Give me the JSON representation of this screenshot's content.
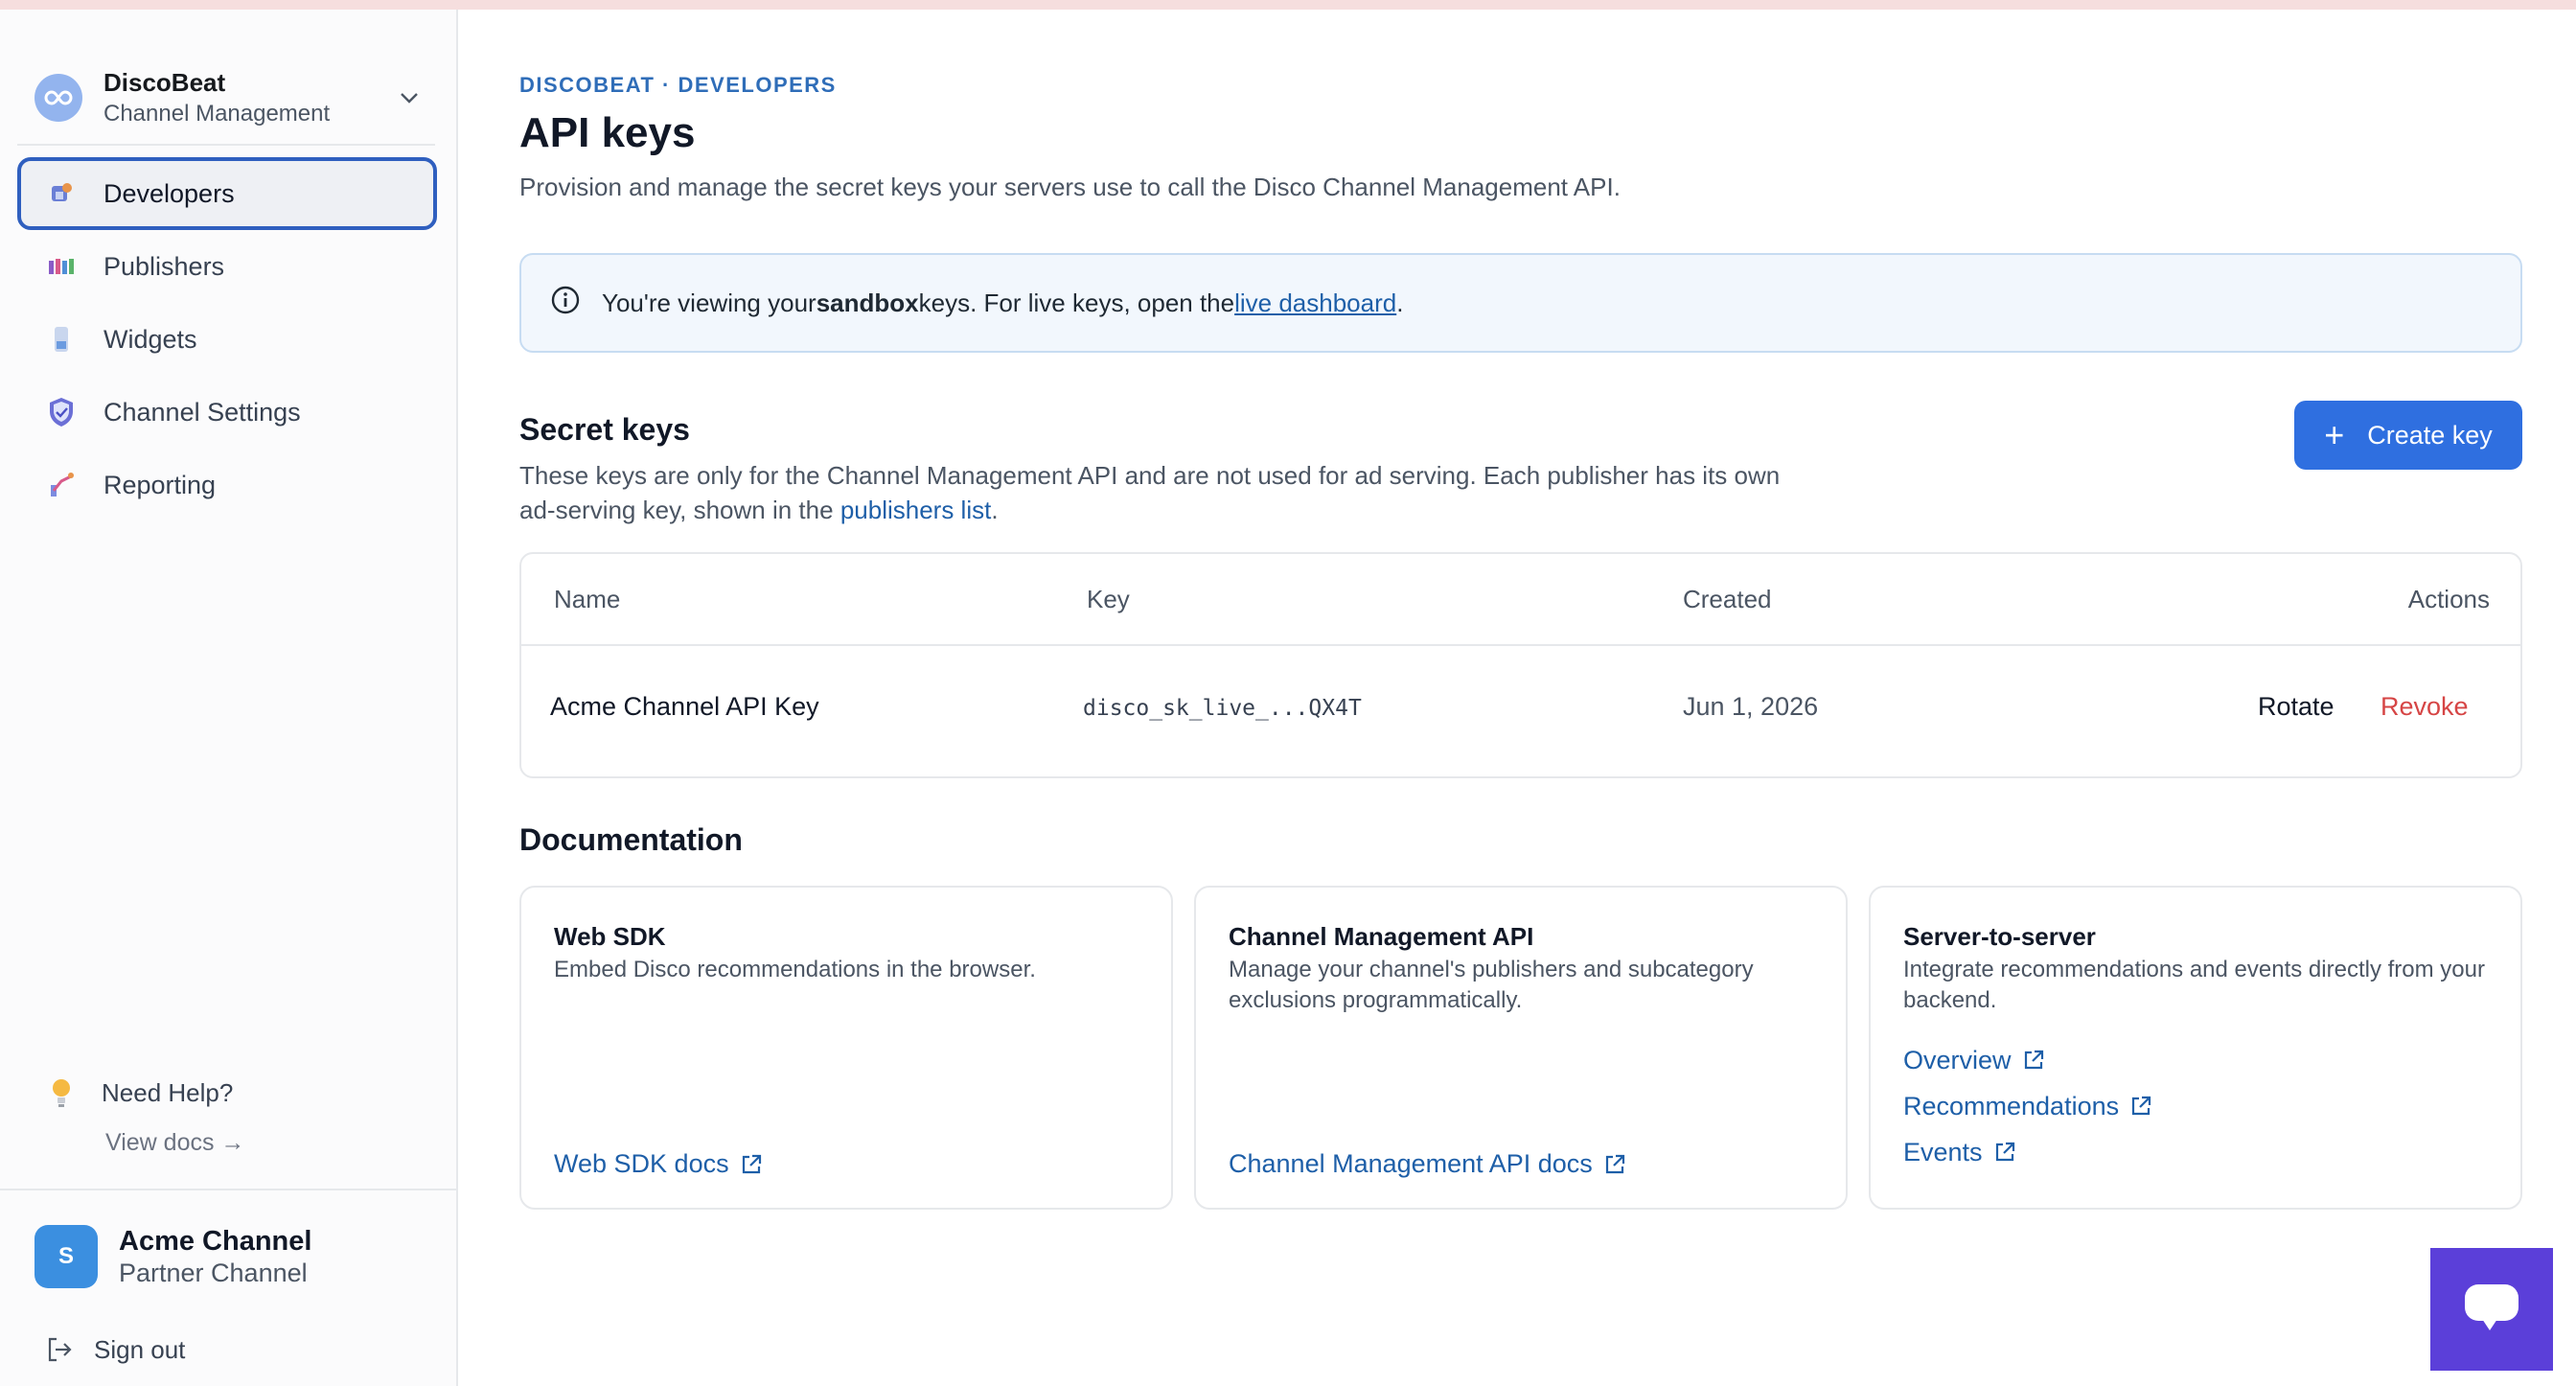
{
  "org": {
    "name": "DiscoBeat",
    "subtitle": "Channel Management"
  },
  "sidebar": {
    "items": [
      {
        "label": "Developers",
        "icon": "developers-icon",
        "active": true
      },
      {
        "label": "Publishers",
        "icon": "publishers-icon",
        "active": false
      },
      {
        "label": "Widgets",
        "icon": "widgets-icon",
        "active": false
      },
      {
        "label": "Channel Settings",
        "icon": "shield-icon",
        "active": false
      },
      {
        "label": "Reporting",
        "icon": "reporting-icon",
        "active": false
      }
    ],
    "help": {
      "label": "Need Help?",
      "link": "View docs →"
    },
    "user": {
      "initial": "S",
      "name": "Acme Channel",
      "role": "Partner Channel"
    },
    "signout": "Sign out"
  },
  "header": {
    "eyebrow": "DISCOBEAT · DEVELOPERS",
    "title": "API keys",
    "description": "Provision and manage the secret keys your servers use to call the Disco Channel Management API."
  },
  "banner": {
    "prefix": "You're viewing your ",
    "bold": "sandbox",
    "middle": " keys. For live keys, open the ",
    "link": "live dashboard",
    "suffix": "."
  },
  "secret_keys": {
    "title": "Secret keys",
    "desc_prefix": "These keys are only for the Channel Management API and are not used for ad serving. Each publisher has its own ad-serving key, shown in the ",
    "desc_link": "publishers list",
    "desc_suffix": ".",
    "create_label": "Create key",
    "columns": {
      "name": "Name",
      "key": "Key",
      "created": "Created",
      "actions": "Actions"
    },
    "rows": [
      {
        "name": "Acme Channel API Key",
        "key": "disco_sk_live_...QX4T",
        "created": "Jun 1, 2026",
        "rotate": "Rotate",
        "revoke": "Revoke"
      }
    ]
  },
  "documentation": {
    "title": "Documentation",
    "cards": [
      {
        "title": "Web SDK",
        "desc": "Embed Disco recommendations in the browser.",
        "link": "Web SDK docs"
      },
      {
        "title": "Channel Management API",
        "desc": "Manage your channel's publishers and subcategory exclusions programmatically.",
        "link": "Channel Management API docs"
      },
      {
        "title": "Server-to-server",
        "desc": "Integrate recommendations and events directly from your backend.",
        "links": [
          "Overview",
          "Recommendations",
          "Events"
        ]
      }
    ]
  },
  "colors": {
    "accent": "#2f6fe0",
    "link": "#1e5fa8",
    "danger": "#d64545",
    "chat": "#5b3fd9"
  }
}
